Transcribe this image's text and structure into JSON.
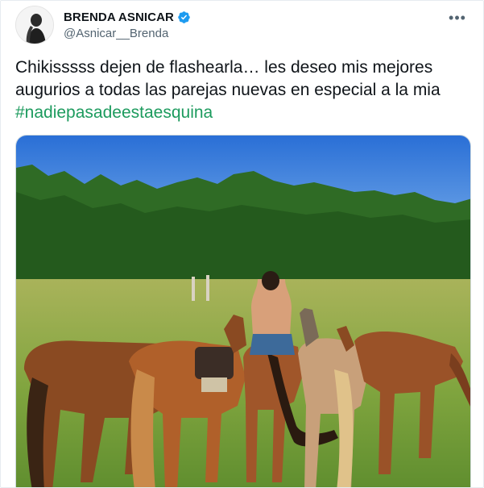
{
  "tweet": {
    "display_name": "BRENDA ASNICAR",
    "handle": "@Asnicar__Brenda",
    "verified_icon": "verified-badge-icon",
    "more_icon": "more-options-icon",
    "text": "Chikisssss dejen de flashearla… les deseo mis mejores augurios a todas las parejas nuevas en especial a la mia ",
    "hashtag": "#nadiepasadeestaesquina",
    "media_icon": "photo-horses-field",
    "colors": {
      "hashtag": "#1d9b5e",
      "verified": "#1d9bf0",
      "sky": "#3b7fe0",
      "grass": "#6f9a3a",
      "trees": "#2f6b25"
    }
  }
}
